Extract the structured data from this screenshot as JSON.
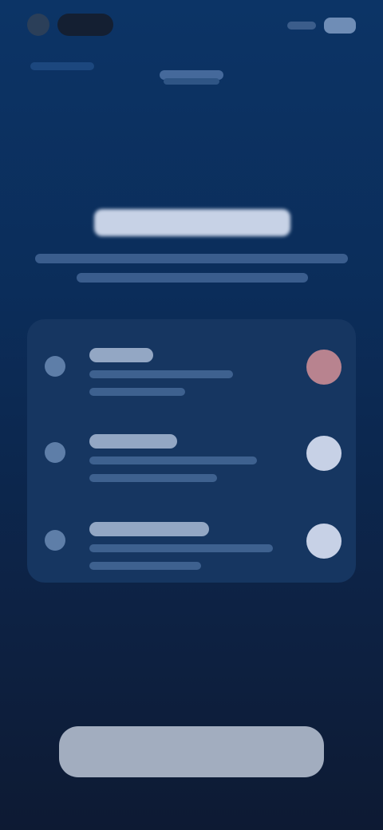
{
  "status_bar": {
    "left_icons": [
      "avatar-icon",
      "pill-icon"
    ],
    "right_icons": [
      "signal-icon",
      "battery-icon"
    ]
  },
  "header": {
    "back_label": "",
    "title": "",
    "subtitle": ""
  },
  "hero": {
    "title": "",
    "subtitle": ""
  },
  "settings": {
    "items": [
      {
        "title": "",
        "description": "",
        "toggle_icon": "toggle-icon",
        "accent": "#b8838f"
      },
      {
        "title": "",
        "description": "",
        "toggle_icon": "toggle-icon",
        "accent": "#c7d1e6"
      },
      {
        "title": "",
        "description": "",
        "toggle_icon": "toggle-icon",
        "accent": "#c7d1e6"
      }
    ]
  },
  "footer": {
    "primary_button": ""
  },
  "colors": {
    "background_top": "#0c3466",
    "background_bottom": "#0d1a33",
    "card": "#163661",
    "button": "#a2adbf"
  }
}
